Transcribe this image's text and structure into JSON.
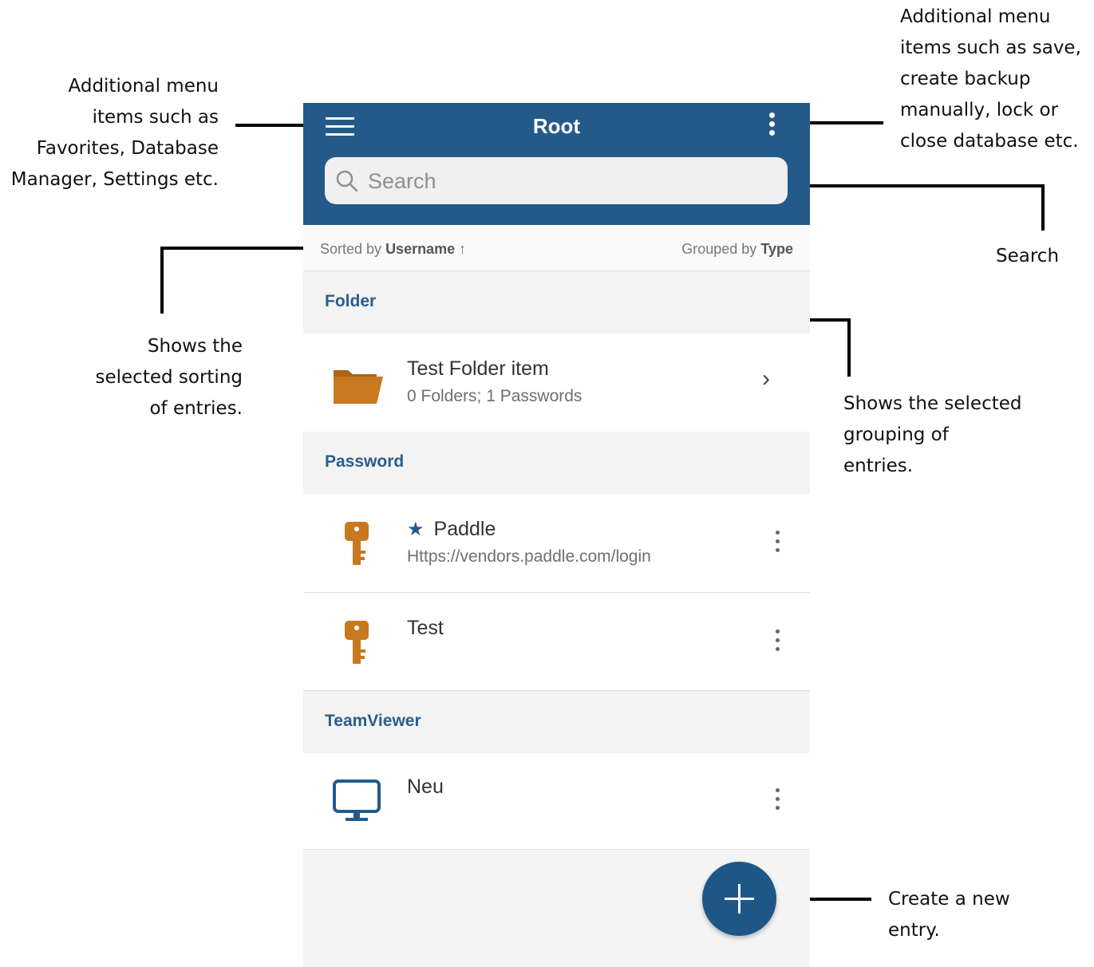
{
  "callouts": {
    "menu_left": [
      "Additional menu",
      "items such as",
      "Favorites, Database",
      "Manager, Settings etc."
    ],
    "menu_right": [
      "Additional menu",
      "items such as save,",
      "create backup",
      "manually, lock or",
      "close database etc."
    ],
    "search": "Search",
    "sorting": [
      "Shows the",
      "selected sorting",
      "of entries."
    ],
    "grouping": [
      "Shows the selected",
      "grouping of",
      "entries."
    ],
    "create": [
      "Create a new",
      "entry."
    ]
  },
  "appbar": {
    "title": "Root",
    "search_placeholder": "Search",
    "color": "#245a8a"
  },
  "sortbar": {
    "sort_prefix": "Sorted by",
    "sort_value": "Username",
    "sort_arrow": "↑",
    "group_prefix": "Grouped by",
    "group_value": "Type"
  },
  "sections": [
    {
      "label": "Folder",
      "items": [
        {
          "icon": "folder-icon",
          "title": "Test Folder item",
          "subtitle": "0 Folders; 1 Passwords",
          "action": "chevron-right-icon"
        }
      ]
    },
    {
      "label": "Password",
      "items": [
        {
          "icon": "key-icon",
          "favorite": "★",
          "title": "Paddle",
          "subtitle": "Https://vendors.paddle.com/login",
          "action": "more-icon"
        },
        {
          "icon": "key-icon",
          "title": "Test",
          "action": "more-icon"
        }
      ]
    },
    {
      "label": "TeamViewer",
      "items": [
        {
          "icon": "monitor-icon",
          "title": "Neu",
          "action": "more-icon"
        }
      ]
    }
  ],
  "fab": {
    "icon": "plus-icon",
    "color": "#1f5688"
  },
  "colors": {
    "accent": "#2a5d8c",
    "icon_orange": "#c8781e"
  }
}
